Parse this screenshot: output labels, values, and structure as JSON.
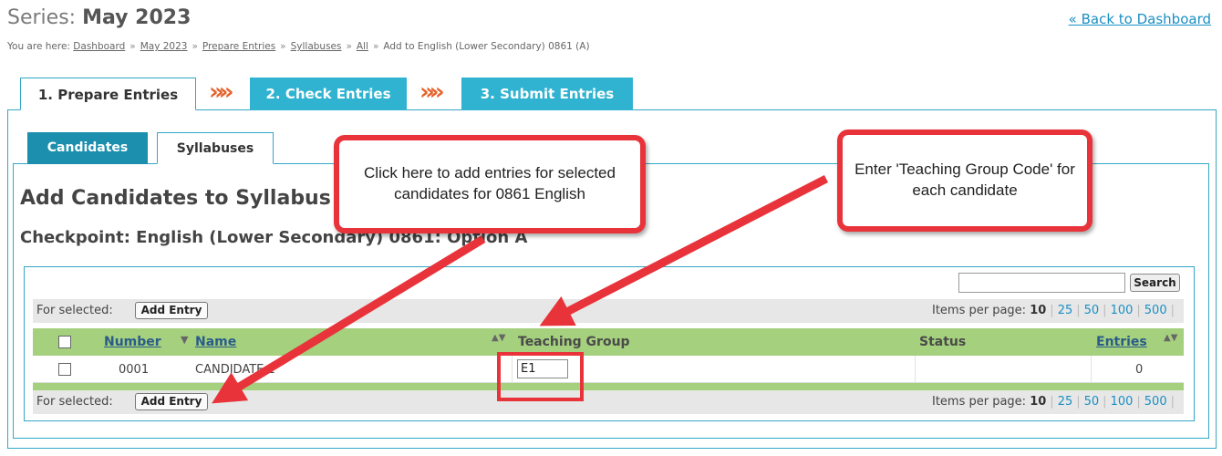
{
  "header": {
    "series_prefix": "Series:",
    "series_name": "May 2023",
    "back_link": "« Back to Dashboard"
  },
  "breadcrumb": {
    "prefix": "You are here:",
    "items": [
      "Dashboard",
      "May 2023",
      "Prepare Entries",
      "Syllabuses",
      "All"
    ],
    "current": "Add to English (Lower Secondary) 0861 (A)",
    "separator": "»"
  },
  "steps": [
    {
      "label": "1. Prepare Entries",
      "active": true
    },
    {
      "label": "2. Check Entries",
      "active": false
    },
    {
      "label": "3. Submit Entries",
      "active": false
    }
  ],
  "step_separator": "»»",
  "subtabs": [
    {
      "label": "Candidates",
      "active": false
    },
    {
      "label": "Syllabuses",
      "active": true
    }
  ],
  "page": {
    "heading": "Add Candidates to Syllabus",
    "subheading": "Checkpoint: English (Lower Secondary) 0861: Option A"
  },
  "search": {
    "value": "",
    "button": "Search"
  },
  "bulk": {
    "label": "For selected:",
    "button": "Add Entry"
  },
  "pagination": {
    "label": "Items per page:",
    "current": "10",
    "options": [
      "25",
      "50",
      "100",
      "500"
    ]
  },
  "table": {
    "columns": {
      "number": "Number",
      "name": "Name",
      "teaching_group": "Teaching Group",
      "status": "Status",
      "entries": "Entries"
    },
    "rows": [
      {
        "number": "0001",
        "name": "CANDIDATE 1",
        "teaching_group": "E1",
        "status": "",
        "entries": "0"
      }
    ]
  },
  "callouts": {
    "add_entry": "Click here to add entries for selected candidates for 0861 English",
    "teaching_group": "Enter 'Teaching Group Code' for each candidate"
  },
  "colors": {
    "tab_blue": "#2fb3d1",
    "panel_border": "#33a6c6",
    "header_green": "#a5d07e",
    "callout_red": "#e8333a",
    "chevron_orange": "#e5632d"
  }
}
